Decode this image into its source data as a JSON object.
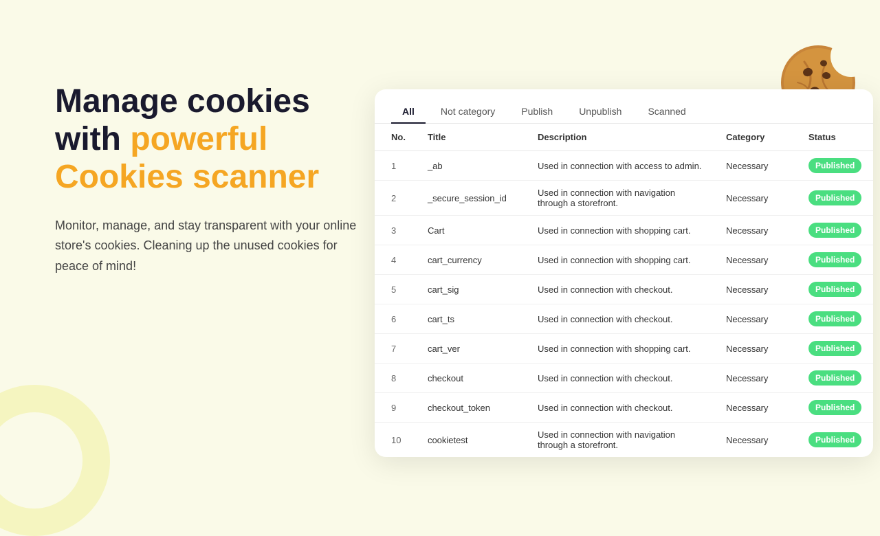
{
  "page": {
    "background": "#fafae8"
  },
  "left": {
    "headline_part1": "Manage cookies",
    "headline_part2": "with ",
    "headline_highlight": "powerful",
    "headline_part3": "Cookies scanner",
    "subtext": "Monitor, manage, and stay transparent with your online store's cookies. Cleaning up the unused cookies for peace of mind!"
  },
  "tabs": [
    {
      "label": "All",
      "active": true
    },
    {
      "label": "Not category",
      "active": false
    },
    {
      "label": "Publish",
      "active": false
    },
    {
      "label": "Unpublish",
      "active": false
    },
    {
      "label": "Scanned",
      "active": false
    }
  ],
  "table": {
    "columns": [
      "No.",
      "Title",
      "Description",
      "Category",
      "Status"
    ],
    "rows": [
      {
        "no": 1,
        "title": "_ab",
        "description": "Used in connection with access to admin.",
        "category": "Necessary",
        "status": "Published"
      },
      {
        "no": 2,
        "title": "_secure_session_id",
        "description": "Used in connection with navigation through a storefront.",
        "category": "Necessary",
        "status": "Published"
      },
      {
        "no": 3,
        "title": "Cart",
        "description": "Used in connection with shopping cart.",
        "category": "Necessary",
        "status": "Published"
      },
      {
        "no": 4,
        "title": "cart_currency",
        "description": "Used in connection with shopping cart.",
        "category": "Necessary",
        "status": "Published"
      },
      {
        "no": 5,
        "title": "cart_sig",
        "description": "Used in connection with checkout.",
        "category": "Necessary",
        "status": "Published"
      },
      {
        "no": 6,
        "title": "cart_ts",
        "description": "Used in connection with checkout.",
        "category": "Necessary",
        "status": "Published"
      },
      {
        "no": 7,
        "title": "cart_ver",
        "description": "Used in connection with shopping cart.",
        "category": "Necessary",
        "status": "Published"
      },
      {
        "no": 8,
        "title": "checkout",
        "description": "Used in connection with checkout.",
        "category": "Necessary",
        "status": "Published"
      },
      {
        "no": 9,
        "title": "checkout_token",
        "description": "Used in connection with checkout.",
        "category": "Necessary",
        "status": "Published"
      },
      {
        "no": 10,
        "title": "cookietest",
        "description": "Used in connection with navigation through a storefront.",
        "category": "Necessary",
        "status": "Published"
      }
    ]
  },
  "status_badge": {
    "label": "Published",
    "bg_color": "#4ade80",
    "text_color": "#fff"
  }
}
